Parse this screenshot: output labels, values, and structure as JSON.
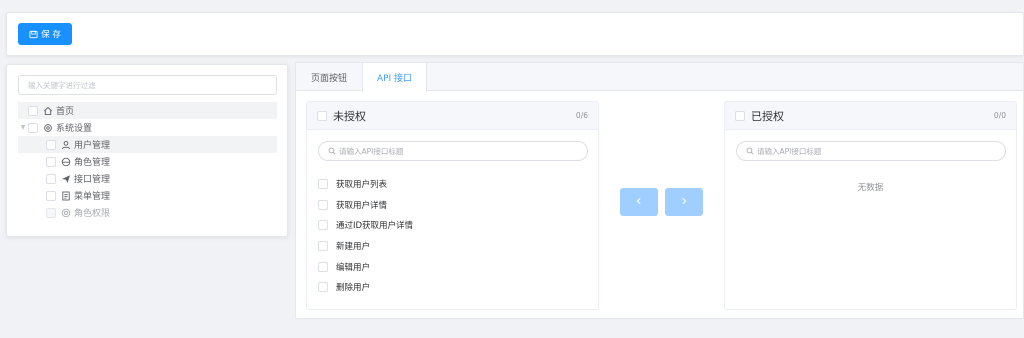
{
  "toolbar": {
    "save_label": "保 存",
    "save_icon": "save-icon"
  },
  "tree": {
    "filter_placeholder": "输入关键字进行过滤",
    "nodes": [
      {
        "label": "首页",
        "icon": "home-icon",
        "level": 0
      },
      {
        "label": "系统设置",
        "icon": "gear-icon",
        "level": 0,
        "expanded": true
      },
      {
        "label": "用户管理",
        "icon": "user-icon",
        "level": 1
      },
      {
        "label": "角色管理",
        "icon": "role-icon",
        "level": 1
      },
      {
        "label": "接口管理",
        "icon": "send-icon",
        "level": 1
      },
      {
        "label": "菜单管理",
        "icon": "menu-doc-icon",
        "level": 1
      },
      {
        "label": "角色权限",
        "icon": "permission-icon",
        "level": 1,
        "disabled": true
      }
    ]
  },
  "tabs": [
    {
      "label": "页面按钮",
      "active": false
    },
    {
      "label": "API 接口",
      "active": true
    }
  ],
  "transfer": {
    "left": {
      "title": "未授权",
      "count": "0/6",
      "search_placeholder": "请输入API接口标题",
      "items": [
        "获取用户列表",
        "获取用户详情",
        "通过ID获取用户详情",
        "新建用户",
        "编辑用户",
        "删除用户"
      ]
    },
    "right": {
      "title": "已授权",
      "count": "0/0",
      "search_placeholder": "请输入API接口标题",
      "empty_text": "无数据"
    },
    "move_left_icon": "chevron-left-icon",
    "move_right_icon": "chevron-right-icon"
  },
  "colors": {
    "primary": "#1890ff",
    "tab_active": "#409eff",
    "disabled_button": "#a0cfff"
  }
}
